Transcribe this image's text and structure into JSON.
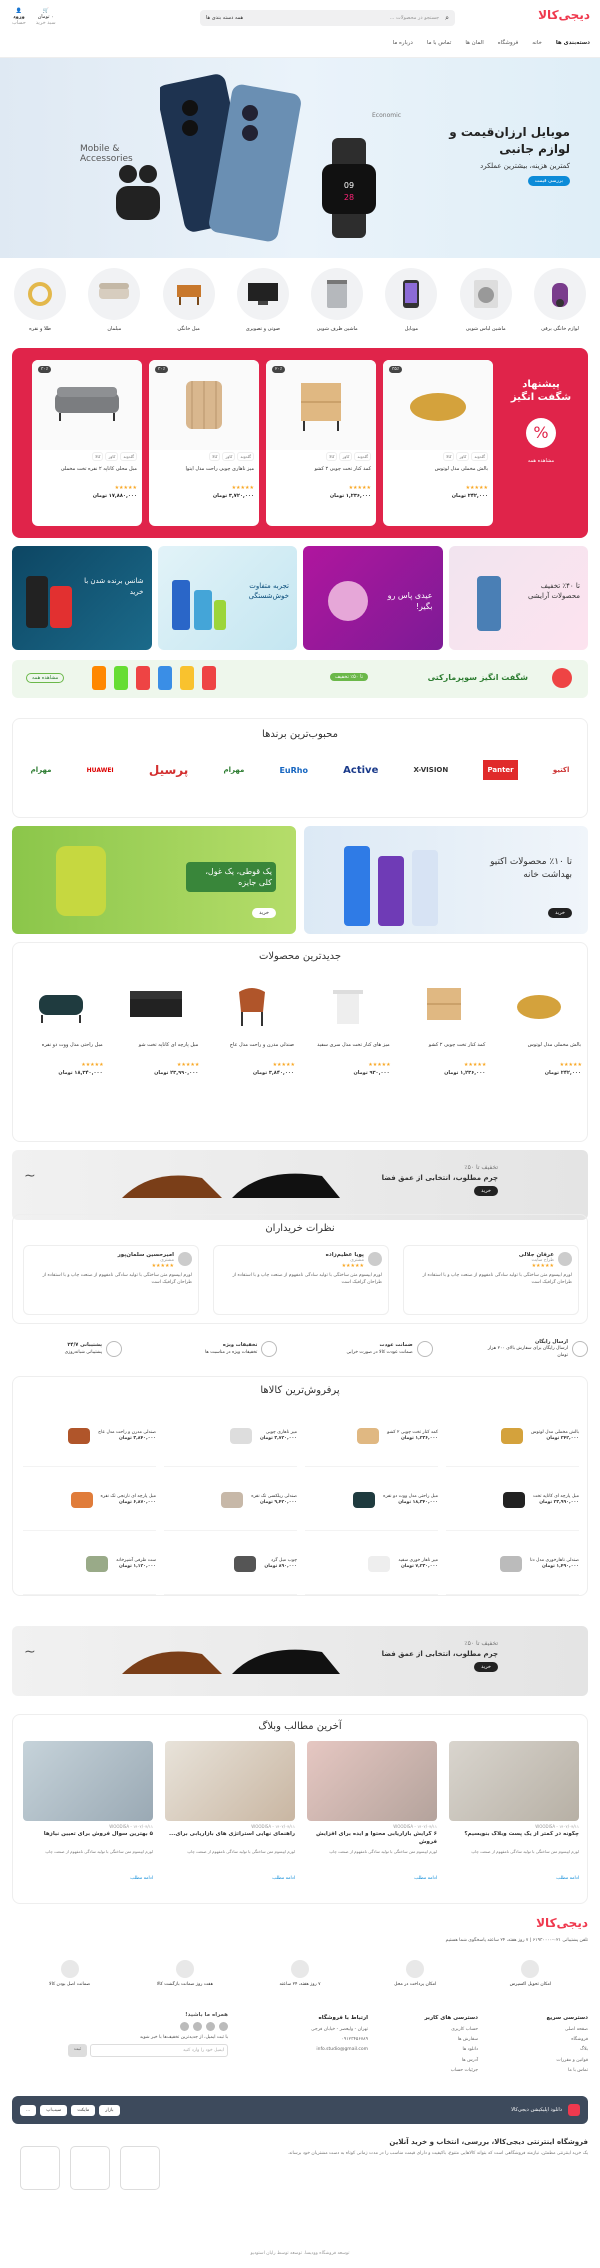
{
  "header": {
    "logo": "دیجی‌کالا",
    "search_category": "همه دسته بندی ها",
    "search_placeholder": "جستجو در محصولات ...",
    "cart_label": "۰ تومان",
    "cart_sub": "سبد خرید",
    "login_label": "ورود",
    "login_sub": "حساب",
    "nav": [
      "دسته‌بندی ها",
      "خانه",
      "فروشگاه",
      "المان ها",
      "تماس با ما",
      "درباره ما"
    ]
  },
  "hero": {
    "title": "موبایل ارزان‌قیمت و لوازم جانبی",
    "subtitle": "کمترین هزینه، بیشترین عملکرد",
    "button": "بررسی قیمت",
    "tag1": "Mobile & Accessories",
    "tag2": "Economic"
  },
  "categories": [
    "لوازم خانگی برقی",
    "ماشین لباس شویی",
    "موبایل",
    "ماشین ظرف شویی",
    "صوتی و تصویری",
    "مبل خانگی",
    "مبلمان",
    "طلا و نقره"
  ],
  "amazing": {
    "title": "پیشنهاد شگفت انگیز",
    "more": "مشاهده همه",
    "products": [
      {
        "title": "بالش مخملی مدل لوتوس",
        "price": "۲۴۲,۰۰۰ تومان",
        "discount": "۳۵٪"
      },
      {
        "title": "کمد کنار تخت چوبی ۲ کشو",
        "price": "۱,۲۳۶,۰۰۰ تومان",
        "discount": "۲۰٪"
      },
      {
        "title": "میز ناهاری چوبی راحت مدل ایتوا",
        "price": "۳,۷۲۰,۰۰۰ تومان",
        "discount": "۳۰٪"
      },
      {
        "title": "مبل محلی کاناپه ۲ نفره تخت مخملی",
        "price": "۱۷,۸۸۰,۰۰۰ تومان",
        "discount": "۳۰٪"
      }
    ],
    "chips": [
      "گلدونه",
      "کاور",
      "کالا"
    ]
  },
  "promo_banners": [
    "تا ۴۰٪ تخفیف محصولات آرایشی",
    "عیدی پاس رو بگیر!",
    "تجربه متفاوت خوش‌شستگی",
    "شانس برنده شدن با خرید"
  ],
  "supermarket": {
    "title": "شگفت انگیز سوپرمارکتی",
    "badge": "تا ۵۰٪ تخفیف",
    "link": "مشاهده همه"
  },
  "brands": {
    "title": "محبوب‌ترین برندها",
    "items": [
      "اکتیو",
      "Panter",
      "X-VISION",
      "Active",
      "EuRho",
      "مهرام",
      "پرسیل",
      "HUAWEI",
      "مهرام"
    ]
  },
  "dual_banners": [
    {
      "title": "تا ۱۰٪ محصولات اکتیو بهداشت خانه",
      "button": "خرید"
    },
    {
      "title": "یک قوطی، یک غول، کلی جایزه",
      "button": "خرید"
    }
  ],
  "newest": {
    "title": "جدیدترین محصولات",
    "products": [
      {
        "title": "بالش مخملی مدل لوتوس",
        "price": "۲۴۲,۰۰۰ تومان"
      },
      {
        "title": "کمد کنار تخت چوبی ۲ کشو",
        "price": "۱,۲۳۶,۰۰۰ تومان"
      },
      {
        "title": "میز های کنار تخت مدل سری سفید",
        "price": "۹۳۰,۰۰۰ تومان"
      },
      {
        "title": "صندلی مدرن و راحت مدل عاج",
        "price": "۳,۸۴۰,۰۰۰ تومان"
      },
      {
        "title": "مبل پارچه ای کاناپه تخت شو",
        "price": "۲۳,۹۹۰,۰۰۰ تومان"
      },
      {
        "title": "مبل راحتی مدل ووت دو نفره",
        "price": "۱۸,۳۴۰,۰۰۰ تومان"
      }
    ]
  },
  "shoe_banner": {
    "discount": "تخفیف تا ۵۰٪",
    "title": "چرم مطلوب، انتخابی از عمق فضا",
    "button": "خرید"
  },
  "reviews": {
    "title": "نظرات خریداران",
    "items": [
      {
        "name": "عرفان جلالی",
        "role": "طراح سایت",
        "text": "لورم ایپسوم متن ساختگی با تولید سادگی نامفهوم از صنعت چاپ و با استفاده از طراحان گرافیک است"
      },
      {
        "name": "پویا عظیم‌زاده",
        "role": "مشتری",
        "text": "لورم ایپسوم متن ساختگی با تولید سادگی نامفهوم از صنعت چاپ و با استفاده از طراحان گرافیک است"
      },
      {
        "name": "امیرحسین سلمان‌پور",
        "role": "مشتری",
        "text": "لورم ایپسوم متن ساختگی با تولید سادگی نامفهوم از صنعت چاپ و با استفاده از طراحان گرافیک است"
      }
    ]
  },
  "services": [
    {
      "title": "ارسال رایگان",
      "desc": "ارسال رایگان برای سفارش بالای ۲۰۰ هزار تومان"
    },
    {
      "title": "ضمانت عودت",
      "desc": "ضمانت عودت کالا در صورت خرابی"
    },
    {
      "title": "تخفیفات ویژه",
      "desc": "تخفیفات ویژه در مناسبت ها"
    },
    {
      "title": "پشتیبانی ۲۴/۷",
      "desc": "پشتیبانی شبانه‌روزی"
    }
  ],
  "bestsellers": {
    "title": "پرفروش‌ترین کالاها",
    "items": [
      {
        "title": "بالش مخملی مدل لوتوس",
        "price": "۲۴۲,۰۰۰ تومان"
      },
      {
        "title": "کمد کنار تخت چوبی ۲ کشو",
        "price": "۱,۲۳۶,۰۰۰ تومان"
      },
      {
        "title": "میز ناهاری چوبی",
        "price": "۳,۷۲۰,۰۰۰ تومان"
      },
      {
        "title": "صندلی مدرن و راحت مدل عاج",
        "price": "۳,۸۴۰,۰۰۰ تومان"
      },
      {
        "title": "مبل پارچه ای کاناپه تخت",
        "price": "۲۳,۹۹۰,۰۰۰ تومان"
      },
      {
        "title": "مبل راحتی مدل ووت دو نفره",
        "price": "۱۸,۳۴۰,۰۰۰ تومان"
      },
      {
        "title": "صندلی ریلکسی تک نفره",
        "price": "۹,۴۲۰,۰۰۰ تومان"
      },
      {
        "title": "مبل پارچه ای نارنجی تک نفره",
        "price": "۶,۸۷۰,۰۰۰ تومان"
      },
      {
        "title": "صندلی ناهارخوری مدل دنا",
        "price": "۱,۴۹۰,۰۰۰ تومان"
      },
      {
        "title": "میز ناهار خوری سفید",
        "price": "۷,۲۳۰,۰۰۰ تومان"
      },
      {
        "title": "چوب مبل گرد",
        "price": "۸۹۰,۰۰۰ تومان"
      },
      {
        "title": "ست ظرفی آشپزخانه",
        "price": "۱,۱۲۰,۰۰۰ تومان"
      }
    ]
  },
  "blog": {
    "title": "آخرین مطالب وبلاگ",
    "posts": [
      {
        "meta": "۱۴۰۲/۰۴/۱۱ - WOODISA",
        "title": "چگونه در کمتر از یک پست وبلاگ بنویسیم؟",
        "excerpt": "لورم ایپسوم متن ساختگی با تولید سادگی نامفهوم از صنعت چاپ",
        "more": "ادامه مطلب"
      },
      {
        "meta": "۱۴۰۲/۰۴/۱۱ - WOODISA",
        "title": "۶ گرایش بازاریابی محتوا و ایده برای افزایش فروش",
        "excerpt": "لورم ایپسوم متن ساختگی با تولید سادگی نامفهوم از صنعت چاپ",
        "more": "ادامه مطلب"
      },
      {
        "meta": "۱۴۰۲/۰۴/۱۱ - WOODISA",
        "title": "راهنمای نهایی استراتژی های بازاریابی برای...",
        "excerpt": "لورم ایپسوم متن ساختگی با تولید سادگی نامفهوم از صنعت چاپ",
        "more": "ادامه مطلب"
      },
      {
        "meta": "۱۴۰۲/۰۴/۱۱ - WOODISA",
        "title": "۵ بهترین سوال فروش برای تعیین نیازها",
        "excerpt": "لورم ایپسوم متن ساختگی با تولید سادگی نامفهوم از صنعت چاپ",
        "more": "ادامه مطلب"
      }
    ]
  },
  "footer": {
    "logo": "دیجی‌کالا",
    "contact": "تلفن پشتیبانی ۰۲۱-۶۱۹۳۰۰۰۰ | ۷ روز هفته، ۲۴ ساعته پاسخگوی شما هستیم",
    "services": [
      "امکان تحویل اکسپرس",
      "امکان پرداخت در محل",
      "۷ روز هفته، ۲۴ ساعته",
      "هفت روز ضمانت بازگشت کالا",
      "ضمانت اصل بودن کالا"
    ],
    "col1_title": "دسترسی سریع",
    "col1": [
      "صفحه اصلی",
      "فروشگاه",
      "بلاگ",
      "قوانین و مقررات",
      "تماس با ما"
    ],
    "col2_title": "دسترسی های کاربر",
    "col2": [
      "حساب کاربری",
      "سفارش ها",
      "دانلود ها",
      "آدرس ها",
      "جزئیات حساب"
    ],
    "col3_title": "ارتباط با فروشگاه",
    "col3": [
      "تهران - ولیعصر - خیابان فرجی",
      "۰۹۱۲۳۴۵۶۷۸۹",
      "info.studio@gmail.com"
    ],
    "news_title": "همراه ما باشید!",
    "news_text": "با ثبت ایمیل، از جدیدترین تخفیف‌ها با خبر شوید",
    "news_placeholder": "ایمیل خود را وارد کنید",
    "news_button": "ثبت",
    "app_text": "دانلود اپلیکیشن دیجی‌کالا",
    "stores": [
      "بازار",
      "مایکت",
      "سیب‌اپ",
      "..."
    ],
    "about_title": "فروشگاه اینترنتی دیجی‌کالا، بررسی، انتخاب و خرید آنلاین",
    "about_text": "یک خرید اینترنتی مطمئن، نیازمند فروشگاهی است که بتواند کالاهایی متنوع، باکیفیت و دارای قیمت مناسب را در مدت زمانی کوتاه به دست مشتریان خود برساند.",
    "copyright": "توسعه فروشگاه وودیسا. توسعه توسط رایان استودیو"
  },
  "colors": {
    "brand": "#ef394e",
    "amazing": "#e0244a",
    "accent": "#0c8bd8"
  }
}
